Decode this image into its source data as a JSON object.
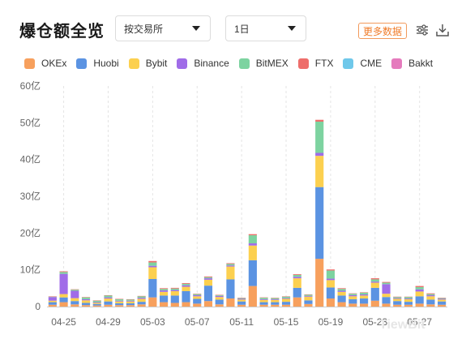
{
  "header": {
    "title": "爆仓额全览",
    "exchange_select": "按交易所",
    "period_select": "1日",
    "more_button": "更多数据",
    "settings_icon": "sliders-icon",
    "download_icon": "download-icon"
  },
  "watermark": "TiewBit",
  "chart_data": {
    "type": "bar",
    "stacked": true,
    "ylim": [
      0,
      60
    ],
    "yticks": [
      "0",
      "10亿",
      "20亿",
      "30亿",
      "40亿",
      "50亿",
      "60亿"
    ],
    "xtick_labels": [
      "04-25",
      "04-29",
      "05-03",
      "05-07",
      "05-11",
      "05-15",
      "05-19",
      "05-23",
      "05-27"
    ],
    "grid": "vertical dashed",
    "legend_position": "top",
    "categories": [
      "04-24",
      "04-25",
      "04-26",
      "04-27",
      "04-28",
      "04-29",
      "04-30",
      "05-01",
      "05-02",
      "05-03",
      "05-04",
      "05-05",
      "05-06",
      "05-07",
      "05-08",
      "05-09",
      "05-10",
      "05-11",
      "05-12",
      "05-13",
      "05-14",
      "05-15",
      "05-16",
      "05-17",
      "05-18",
      "05-19",
      "05-20",
      "05-21",
      "05-22",
      "05-23",
      "05-24",
      "05-25",
      "05-26",
      "05-27",
      "05-28",
      "05-29"
    ],
    "series": [
      {
        "name": "OKEx",
        "color": "#f7a05d",
        "values": [
          0.5,
          1.2,
          0.6,
          0.4,
          0.3,
          0.5,
          0.4,
          0.4,
          0.6,
          2.5,
          1.2,
          1.0,
          1.2,
          0.8,
          1.5,
          0.6,
          2.2,
          0.5,
          5.6,
          0.5,
          0.5,
          0.5,
          2.5,
          0.7,
          13.0,
          2.2,
          1.2,
          0.8,
          0.8,
          1.6,
          0.8,
          0.5,
          0.5,
          0.8,
          0.6,
          0.5
        ]
      },
      {
        "name": "Huobi",
        "color": "#5b93e2",
        "values": [
          0.7,
          1.3,
          0.9,
          0.6,
          0.4,
          0.9,
          0.5,
          0.5,
          0.7,
          5.0,
          1.8,
          2.0,
          3.0,
          1.3,
          4.2,
          1.3,
          5.2,
          0.9,
          7.0,
          0.7,
          0.7,
          0.8,
          2.6,
          1.0,
          19.5,
          3.0,
          1.8,
          1.2,
          1.4,
          3.5,
          1.8,
          1.0,
          0.8,
          2.0,
          1.3,
          0.9
        ]
      },
      {
        "name": "Bybit",
        "color": "#fcd04f",
        "values": [
          0.4,
          0.9,
          0.8,
          0.7,
          0.3,
          0.8,
          0.5,
          0.5,
          0.8,
          3.2,
          1.0,
          1.2,
          1.2,
          0.7,
          1.6,
          0.7,
          3.5,
          0.5,
          4.0,
          0.6,
          0.6,
          0.8,
          2.6,
          1.0,
          8.5,
          2.0,
          1.0,
          0.8,
          0.8,
          1.4,
          0.9,
          0.6,
          0.7,
          1.3,
          0.9,
          0.5
        ]
      },
      {
        "name": "Binance",
        "color": "#a06ce8",
        "values": [
          1.0,
          5.5,
          2.0,
          0.3,
          0.2,
          0.3,
          0.2,
          0.2,
          0.3,
          0.4,
          0.4,
          0.3,
          0.4,
          0.3,
          0.4,
          0.3,
          0.3,
          0.2,
          0.6,
          0.2,
          0.2,
          0.2,
          0.4,
          0.2,
          0.8,
          0.4,
          0.3,
          0.3,
          0.3,
          0.3,
          2.6,
          0.2,
          0.2,
          0.6,
          0.3,
          0.2
        ]
      },
      {
        "name": "BitMEX",
        "color": "#7dd3a0",
        "values": [
          0.1,
          0.5,
          0.3,
          0.5,
          0.4,
          0.5,
          0.4,
          0.3,
          0.4,
          0.9,
          0.4,
          0.4,
          0.4,
          0.3,
          0.3,
          0.2,
          0.4,
          0.2,
          2.2,
          0.4,
          0.3,
          0.4,
          0.5,
          0.3,
          8.5,
          2.2,
          0.5,
          0.4,
          0.5,
          0.6,
          0.4,
          0.3,
          0.4,
          0.6,
          0.3,
          0.2
        ]
      },
      {
        "name": "FTX",
        "color": "#ee6e6b",
        "values": [
          0.1,
          0.2,
          0.1,
          0.1,
          0.1,
          0.1,
          0.1,
          0.1,
          0.1,
          0.4,
          0.2,
          0.2,
          0.2,
          0.1,
          0.2,
          0.1,
          0.2,
          0.1,
          0.3,
          0.1,
          0.1,
          0.1,
          0.2,
          0.1,
          0.5,
          0.3,
          0.2,
          0.1,
          0.1,
          0.3,
          0.2,
          0.1,
          0.1,
          0.3,
          0.2,
          0.1
        ]
      },
      {
        "name": "CME",
        "color": "#6fc8ea",
        "values": [
          0,
          0,
          0,
          0,
          0,
          0,
          0,
          0,
          0,
          0,
          0,
          0,
          0,
          0,
          0,
          0,
          0,
          0,
          0,
          0,
          0,
          0,
          0,
          0,
          0,
          0,
          0,
          0,
          0,
          0,
          0,
          0,
          0,
          0,
          0,
          0
        ]
      },
      {
        "name": "Bakkt",
        "color": "#e57bbd",
        "values": [
          0,
          0,
          0,
          0,
          0,
          0,
          0,
          0,
          0,
          0,
          0,
          0,
          0,
          0,
          0,
          0,
          0,
          0,
          0,
          0,
          0,
          0,
          0,
          0,
          0,
          0,
          0,
          0,
          0,
          0,
          0,
          0,
          0,
          0,
          0,
          0
        ]
      }
    ]
  }
}
